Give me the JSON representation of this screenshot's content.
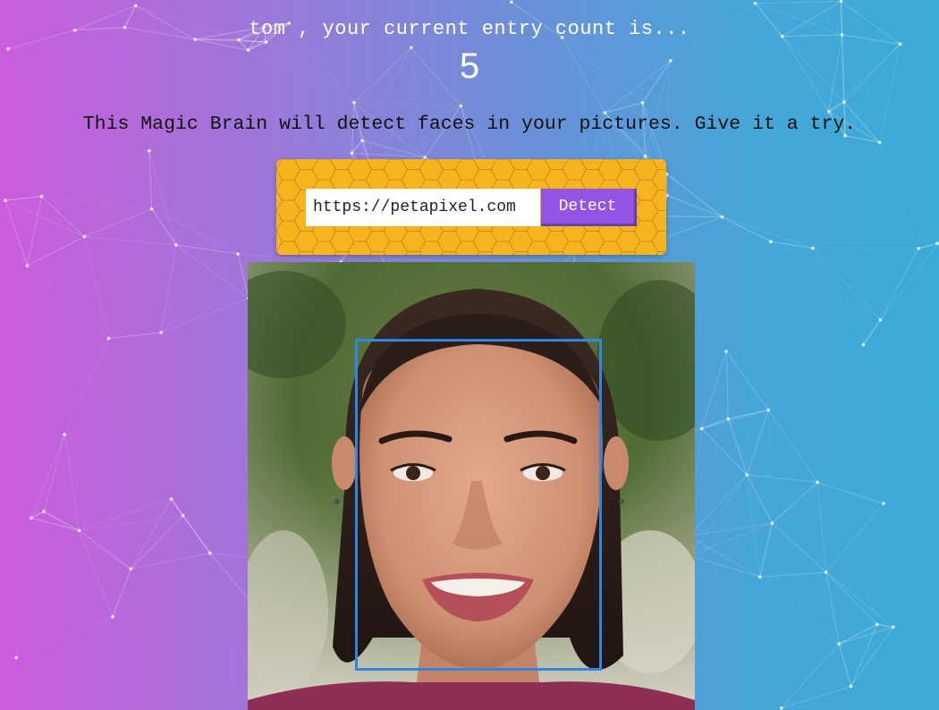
{
  "rank": {
    "user_name": "tom",
    "message": "tom , your current entry count is...",
    "count": "5"
  },
  "intro": {
    "text": "This Magic Brain will detect faces in your pictures. Give it a try."
  },
  "form": {
    "url_value": "https://petapixel.com",
    "detect_label": "Detect"
  },
  "result": {
    "image_alt": "Portrait photo of a smiling young woman",
    "face_count": 1
  },
  "colors": {
    "gradient_left": "#cd5cdc",
    "gradient_right": "#3aabd6",
    "panel_yellow": "#f6b41f",
    "button_purple": "#9553e6",
    "box_blue": "#2f86e3"
  }
}
